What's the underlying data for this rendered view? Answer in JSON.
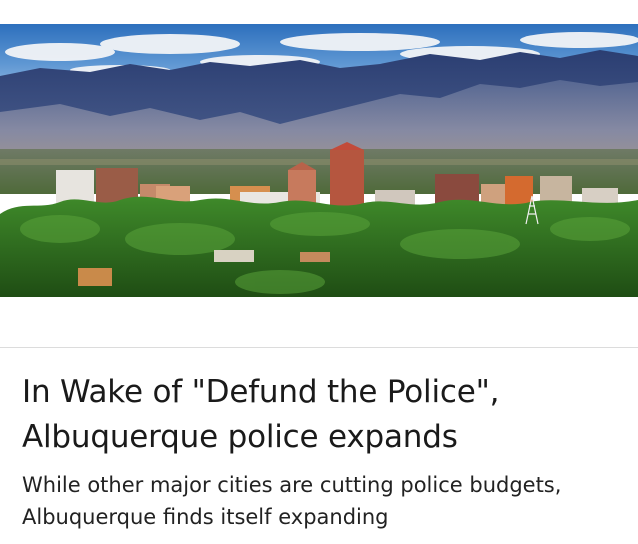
{
  "article": {
    "image_alt": "Albuquerque skyline with the Sandia Mountains",
    "headline": "In Wake of \"Defund the Police\", Albuquerque police expands",
    "subheadline": "While other major cities are cutting police budgets, Albuquerque finds itself expanding"
  }
}
